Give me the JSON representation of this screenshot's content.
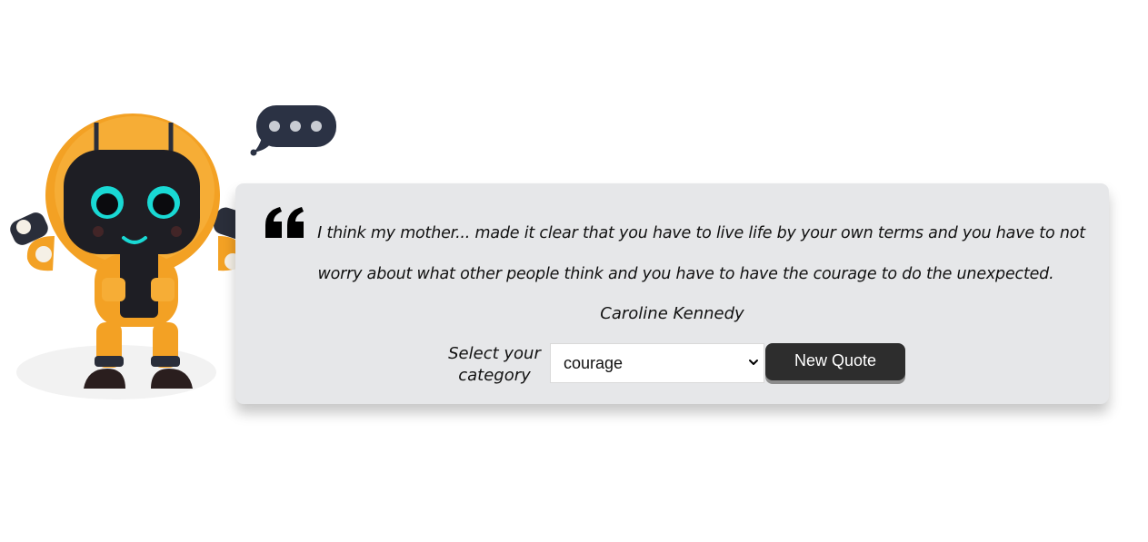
{
  "quote": {
    "text": "I think my mother... made it clear that you have to live life by your own terms and you have to not worry about what other people think and you have to have the courage to do the unexpected.",
    "author": "Caroline Kennedy"
  },
  "controls": {
    "category_label": "Select your category",
    "category_value": "courage",
    "button_label": "New Quote"
  },
  "colors": {
    "card_bg": "#e6e7e9",
    "button_bg": "#2d2d2d",
    "robot_body": "#f3a124",
    "robot_face": "#1e1e24",
    "robot_eyes": "#19d9d4",
    "bubble": "#2b3244"
  },
  "icons": {
    "quote_mark": "quote-open-icon",
    "dropdown": "chevron-down-icon",
    "speech_bubble": "typing-bubble-icon"
  }
}
